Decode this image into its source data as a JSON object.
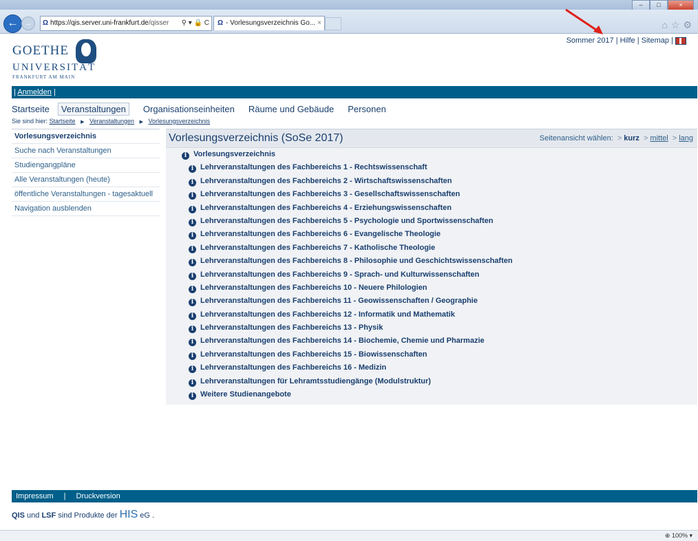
{
  "browser": {
    "url_host": "https://qis.server.uni-frankfurt.de",
    "url_rest": "/qisser",
    "url_controls": "⚲ ▾ 🔒 C",
    "tab_title": "- Vorlesungsverzeichnis Go...",
    "tab_close": "×",
    "zoom_level": "100%"
  },
  "logo": {
    "line1": "GOETHE",
    "line2": "UNIVERSITÄT",
    "line3": "FRANKFURT AM MAIN"
  },
  "top_links": {
    "semester": "Sommer 2017",
    "sep1": "|",
    "help": "Hilfe",
    "sep2": "|",
    "sitemap": "Sitemap",
    "sep3": "|"
  },
  "login_bar": {
    "pre": "|",
    "login": "Anmelden",
    "post": "|"
  },
  "main_nav": [
    {
      "label": "Startseite"
    },
    {
      "label": "Veranstaltungen"
    },
    {
      "label": "Organisationseinheiten"
    },
    {
      "label": "Räume und Gebäude"
    },
    {
      "label": "Personen"
    }
  ],
  "breadcrumb": {
    "prefix": "Sie sind hier:",
    "items": [
      "Startseite",
      "Veranstaltungen",
      "Vorlesungsverzeichnis"
    ],
    "sep_icon": "▶"
  },
  "sidebar": [
    {
      "label": "Vorlesungsverzeichnis"
    },
    {
      "label": "Suche nach Veranstaltungen"
    },
    {
      "label": "Studiengangpläne"
    },
    {
      "label": "Alle Veranstaltungen (heute)"
    },
    {
      "label": "öffentliche Veranstaltungen - tagesaktuell"
    },
    {
      "label": "Navigation ausblenden"
    }
  ],
  "content": {
    "title": "Vorlesungsverzeichnis (SoSe 2017)",
    "view_prefix": "Seitenansicht wählen:",
    "view_arrow": ">",
    "view_kurz": "kurz",
    "view_mittel": "mittel",
    "view_lang": "lang",
    "info_icon": "i",
    "root": "Vorlesungsverzeichnis",
    "children": [
      "Lehrveranstaltungen des Fachbereichs 1 - Rechtswissenschaft",
      "Lehrveranstaltungen des Fachbereichs 2 - Wirtschaftswissenschaften",
      "Lehrveranstaltungen des Fachbereichs 3 - Gesellschaftswissenschaften",
      "Lehrveranstaltungen des Fachbereichs 4 - Erziehungswissenschaften",
      "Lehrveranstaltungen des Fachbereichs 5 - Psychologie und Sportwissenschaften",
      "Lehrveranstaltungen des Fachbereichs 6 - Evangelische Theologie",
      "Lehrveranstaltungen des Fachbereichs 7 - Katholische Theologie",
      "Lehrveranstaltungen des Fachbereichs 8 - Philosophie und Geschichtswissenschaften",
      "Lehrveranstaltungen des Fachbereichs 9 - Sprach- und Kulturwissenschaften",
      "Lehrveranstaltungen des Fachbereichs 10 - Neuere Philologien",
      "Lehrveranstaltungen des Fachbereichs 11 - Geowissenschaften / Geographie",
      "Lehrveranstaltungen des Fachbereichs 12 - Informatik und Mathematik",
      "Lehrveranstaltungen des Fachbereichs 13 - Physik",
      "Lehrveranstaltungen des Fachbereichs 14 - Biochemie, Chemie und Pharmazie",
      "Lehrveranstaltungen des Fachbereichs 15 - Biowissenschaften",
      "Lehrveranstaltungen des Fachbereichs 16 - Medizin",
      "Lehrveranstaltungen für Lehramtsstudiengänge (Modulstruktur)",
      "Weitere Studienangebote"
    ]
  },
  "footer": {
    "impressum": "Impressum",
    "sep": "|",
    "druck": "Druckversion",
    "qis": "QIS",
    "und": "und",
    "lsf": "LSF",
    "produkte": "sind Produkte der",
    "his": "HIS",
    "eg": "eG ."
  },
  "colors": {
    "brand_blue": "#005f8a",
    "link": "#1a3f6f",
    "content_bg": "#f0f2f5"
  }
}
